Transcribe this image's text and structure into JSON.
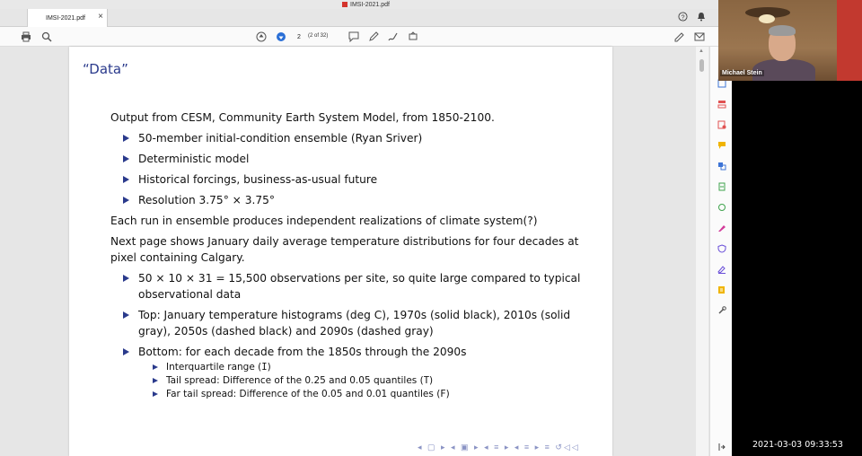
{
  "window": {
    "title": "IMSI-2021.pdf"
  },
  "tab": {
    "label": "IMSI-2021.pdf",
    "close": "×"
  },
  "header_icons": {
    "help": "?",
    "bell": "♠"
  },
  "toolbar": {
    "page_number": "2",
    "page_count": "(2 of 32)"
  },
  "slide": {
    "title": "“Data”",
    "intro": "Output from CESM, Community Earth System Model, from 1850-2100.",
    "bullets1": [
      "50-member initial-condition ensemble (Ryan Sriver)",
      "Deterministic model",
      "Historical forcings, business-as-usual future",
      "Resolution 3.75° × 3.75°"
    ],
    "para2": "Each run in ensemble produces independent realizations of climate system(?)",
    "para3": "Next page shows January daily average temperature distributions for four decades at pixel containing Calgary.",
    "bullets2": [
      "50 × 10 × 31 = 15,500 observations per site, so quite large compared to typical observational data",
      "Top: January temperature histograms (deg C), 1970s (solid black), 2010s (solid gray), 2050s (dashed black) and 2090s (dashed gray)",
      "Bottom: for each decade from the 1850s through the 2090s"
    ],
    "sub_bullets": [
      {
        "text": "Interquartile range (",
        "code": "I",
        "end": ")"
      },
      {
        "text": "Tail spread: Difference of the 0.25 and 0.05 quantiles (",
        "code": "T",
        "end": ")"
      },
      {
        "text": "Far tail spread: Difference of the 0.05 and 0.01 quantiles (",
        "code": "F",
        "end": ")"
      }
    ],
    "nav": "◂ ▢ ▸ ◂ ▣ ▸ ◂ ≡ ▸ ◂ ≡ ▸ ≡ ↺◁◁"
  },
  "video": {
    "participant_name": "Michael Stein"
  },
  "clock": "2021-03-03 09:33:53",
  "colors": {
    "accent": "#2a3a8c",
    "rp_icons": [
      "#3d74d6",
      "#e05252",
      "#e05252",
      "#f0b400",
      "#3d74d6",
      "#3fa34d",
      "#3fa34d",
      "#d23b9a",
      "#6a4fd8",
      "#6a4fd8",
      "#f0b400",
      "#555555"
    ]
  }
}
